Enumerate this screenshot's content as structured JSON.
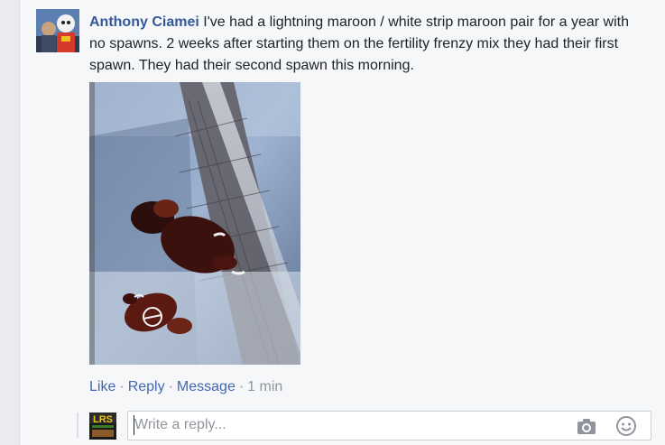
{
  "comment": {
    "author": "Anthony Ciamei",
    "text": "I've had a lightning maroon / white strip maroon pair for a year with no spawns. 2 weeks after starting them on the fertility frenzy mix they had their first spawn. They had their second spawn this morning."
  },
  "actions": {
    "like": "Like",
    "reply": "Reply",
    "message": "Message",
    "separator": "·",
    "timestamp": "1 min"
  },
  "reply": {
    "avatar_text": "LRS",
    "placeholder": "Write a reply..."
  },
  "icons": {
    "camera": "camera-icon",
    "emoji": "emoji-icon"
  },
  "colors": {
    "author_link": "#365899",
    "action_link": "#4267b2",
    "meta_text": "#90949c"
  }
}
